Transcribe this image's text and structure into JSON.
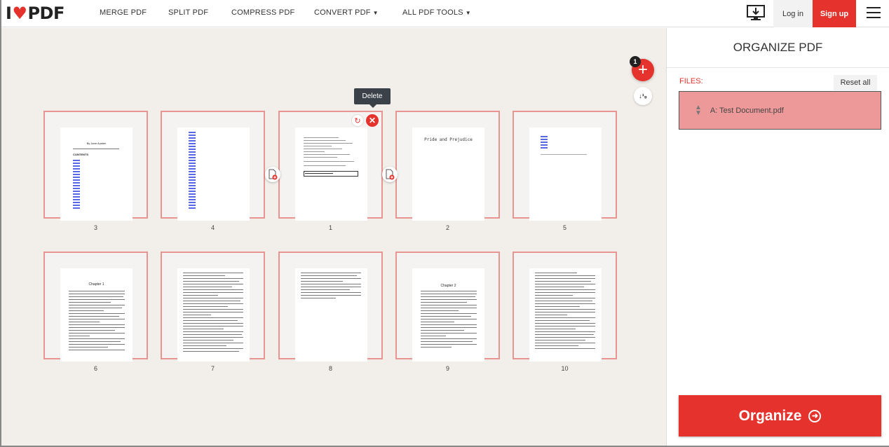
{
  "header": {
    "logo_i": "I",
    "logo_pdf": "PDF",
    "nav": [
      {
        "label": "MERGE PDF"
      },
      {
        "label": "SPLIT PDF"
      },
      {
        "label": "COMPRESS PDF"
      },
      {
        "label": "CONVERT PDF"
      },
      {
        "label": "ALL PDF TOOLS"
      }
    ],
    "login": "Log in",
    "signup": "Sign up"
  },
  "workspace": {
    "tooltip": "Delete",
    "add_badge": "1",
    "pages_row1": [
      "3",
      "4",
      "1",
      "2",
      "5"
    ],
    "pages_row2": [
      "6",
      "7",
      "8",
      "9",
      "10"
    ],
    "page_text": {
      "toc_title": "By Jane Austen",
      "toc_heading": "CONTENTS",
      "pride_title": "Pride and Prejudice",
      "chapter1": "Chapter 1",
      "chapter2": "Chapter 2"
    }
  },
  "sidebar": {
    "title": "ORGANIZE PDF",
    "files_label": "FILES:",
    "reset": "Reset all",
    "file_name": "A: Test Document.pdf",
    "organize": "Organize"
  },
  "colors": {
    "brand": "#e5322d",
    "card_border": "#e89491",
    "file_bg": "#ed9999"
  }
}
